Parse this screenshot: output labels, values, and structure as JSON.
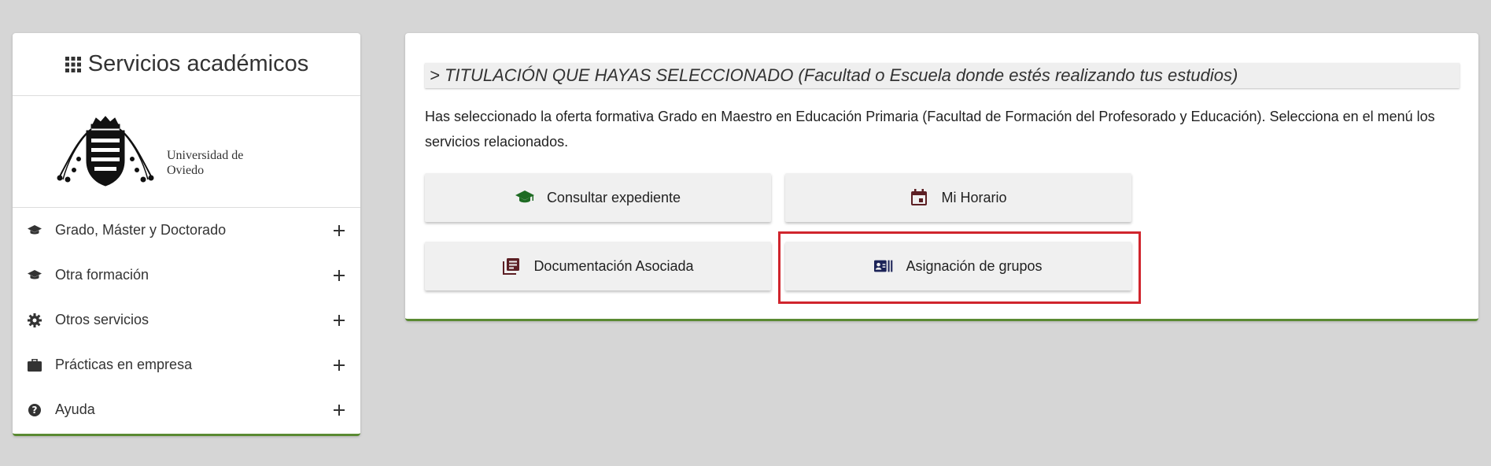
{
  "sidebar": {
    "title": "Servicios académicos",
    "university": {
      "line1": "Universidad de",
      "line2": "Oviedo"
    },
    "items": [
      {
        "label": "Grado, Máster y Doctorado",
        "icon": "graduation-cap-icon"
      },
      {
        "label": "Otra formación",
        "icon": "graduation-cap-icon"
      },
      {
        "label": "Otros servicios",
        "icon": "gear-icon"
      },
      {
        "label": "Prácticas en empresa",
        "icon": "briefcase-icon"
      },
      {
        "label": "Ayuda",
        "icon": "help-icon"
      }
    ]
  },
  "main": {
    "section_title": "> TITULACIÓN QUE HAYAS SELECCIONADO (Facultad o Escuela donde estés realizando tus estudios)",
    "description": "Has seleccionado la oferta formativa Grado en Maestro en Educación Primaria (Facultad de Formación del Profesorado y Educación). Selecciona en el menú los servicios relacionados.",
    "buttons": [
      {
        "label": "Consultar expediente",
        "icon": "graduation-cap-icon"
      },
      {
        "label": "Mi Horario",
        "icon": "calendar-icon"
      },
      {
        "label": "Documentación Asociada",
        "icon": "documents-icon"
      },
      {
        "label": "Asignación de grupos",
        "icon": "id-card-icon"
      }
    ]
  },
  "colors": {
    "accent_green": "#5a8a32",
    "highlight_red": "#d0252d",
    "icon_green": "#1e6b23",
    "icon_maroon": "#5c1f24",
    "icon_navy": "#1c2358"
  }
}
